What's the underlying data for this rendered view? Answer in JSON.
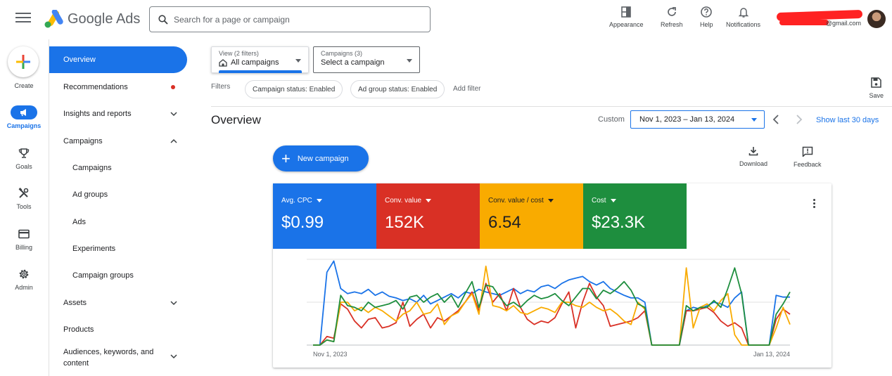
{
  "header": {
    "brand": "Google Ads",
    "search_placeholder": "Search for a page or campaign",
    "buttons": [
      {
        "label": "Appearance",
        "icon": "appearance-icon"
      },
      {
        "label": "Refresh",
        "icon": "refresh-icon"
      },
      {
        "label": "Help",
        "icon": "help-icon"
      },
      {
        "label": "Notifications",
        "icon": "bell-icon"
      }
    ],
    "account_email": "@gmail.com"
  },
  "rail": {
    "create": "Create",
    "items": [
      {
        "label": "Campaigns",
        "icon": "megaphone-icon",
        "active": true
      },
      {
        "label": "Goals",
        "icon": "trophy-icon"
      },
      {
        "label": "Tools",
        "icon": "tools-icon"
      },
      {
        "label": "Billing",
        "icon": "card-icon"
      },
      {
        "label": "Admin",
        "icon": "gear-icon"
      }
    ]
  },
  "nav": {
    "items": [
      {
        "label": "Overview",
        "active": true
      },
      {
        "label": "Recommendations",
        "dot": true
      },
      {
        "label": "Insights and reports",
        "chevron": "down"
      },
      {
        "label": "Campaigns",
        "chevron": "up"
      },
      {
        "label": "Campaigns",
        "sub": true
      },
      {
        "label": "Ad groups",
        "sub": true
      },
      {
        "label": "Ads",
        "sub": true
      },
      {
        "label": "Experiments",
        "sub": true
      },
      {
        "label": "Campaign groups",
        "sub": true
      },
      {
        "label": "Assets",
        "chevron": "down"
      },
      {
        "label": "Products"
      },
      {
        "label": "Audiences, keywords, and content",
        "chevron": "down"
      }
    ]
  },
  "toolbar": {
    "view_small": "View (2 filters)",
    "view_value": "All campaigns",
    "campaigns_small": "Campaigns (3)",
    "campaigns_value": "Select a campaign",
    "filters_label": "Filters",
    "chips": [
      "Campaign status: Enabled",
      "Ad group status: Enabled"
    ],
    "add_filter": "Add filter",
    "save": "Save"
  },
  "overview": {
    "title": "Overview",
    "custom": "Custom",
    "date_range": "Nov 1, 2023 – Jan 13, 2024",
    "show_last": "Show last 30 days",
    "new_campaign": "New campaign",
    "download": "Download",
    "feedback": "Feedback"
  },
  "metrics": [
    {
      "name": "Avg. CPC",
      "value": "$0.99",
      "color": "#1a73e8"
    },
    {
      "name": "Conv. value",
      "value": "152K",
      "color": "#d93025"
    },
    {
      "name": "Conv. value / cost",
      "value": "6.54",
      "color": "#f9ab00"
    },
    {
      "name": "Cost",
      "value": "$23.3K",
      "color": "#1e8e3e"
    }
  ],
  "chart_data": {
    "type": "line",
    "x_start": "Nov 1, 2023",
    "x_end": "Jan 13, 2024",
    "ylim": [
      0,
      1
    ],
    "grid": true,
    "series": [
      {
        "color": "#1a73e8",
        "values": [
          0,
          0,
          0.85,
          0.98,
          0.66,
          0.6,
          0.62,
          0.6,
          0.65,
          0.58,
          0.62,
          0.57,
          0.55,
          0.52,
          0.54,
          0.5,
          0.58,
          0.48,
          0.52,
          0.56,
          0.6,
          0.55,
          0.62,
          0.6,
          0.65,
          0.62,
          0.6,
          0.58,
          0.62,
          0.66,
          0.6,
          0.64,
          0.62,
          0.68,
          0.7,
          0.66,
          0.72,
          0.76,
          0.78,
          0.8,
          0.74,
          0.7,
          0.74,
          0.66,
          0.62,
          0.58,
          0.55,
          0.55,
          0.5,
          0,
          0,
          0,
          0,
          0,
          0.4,
          0.44,
          0.42,
          0.46,
          0.5,
          0.48,
          0.44,
          0.55,
          0.62,
          0,
          0,
          0,
          0,
          0.58,
          0.56,
          0.56
        ]
      },
      {
        "color": "#d93025",
        "values": [
          0,
          0,
          0.1,
          0.08,
          0.48,
          0.42,
          0.28,
          0.2,
          0.3,
          0.32,
          0.2,
          0.22,
          0.26,
          0.5,
          0.22,
          0.3,
          0.36,
          0.2,
          0.32,
          0.28,
          0.34,
          0.4,
          0.5,
          0.62,
          0.4,
          0.72,
          0.5,
          0.6,
          0.4,
          0.66,
          0.44,
          0.3,
          0.24,
          0.28,
          0.26,
          0.32,
          0.48,
          0.62,
          0.2,
          0.5,
          0.72,
          0.56,
          0.46,
          0.22,
          0.24,
          0.26,
          0.28,
          0.32,
          0.4,
          0,
          0,
          0,
          0,
          0,
          0.4,
          0.4,
          0.42,
          0.44,
          0.38,
          0.28,
          0.22,
          0.26,
          0.2,
          0,
          0,
          0,
          0,
          0.3,
          0.42,
          0.36
        ]
      },
      {
        "color": "#f9ab00",
        "values": [
          0,
          0,
          0.06,
          0.04,
          0.5,
          0.5,
          0.4,
          0.44,
          0.38,
          0.44,
          0.4,
          0.34,
          0.28,
          0.36,
          0.4,
          0.5,
          0.36,
          0.38,
          0.48,
          0.24,
          0.34,
          0.38,
          0.5,
          0.6,
          0.36,
          0.92,
          0.46,
          0.44,
          0.4,
          0.46,
          0.38,
          0.36,
          0.4,
          0.44,
          0.42,
          0.38,
          0.5,
          0.5,
          0.46,
          0.44,
          0.5,
          0.44,
          0.4,
          0.42,
          0.36,
          0.28,
          0.24,
          0.5,
          0.42,
          0,
          0,
          0,
          0,
          0,
          0.9,
          0.2,
          0.44,
          0.48,
          0.4,
          0.52,
          0.6,
          0.12,
          0,
          0,
          0,
          0,
          0,
          0.2,
          0.44,
          0.24
        ]
      },
      {
        "color": "#1e8e3e",
        "values": [
          0,
          0,
          0.06,
          0.04,
          0.58,
          0.46,
          0.44,
          0.4,
          0.5,
          0.44,
          0.46,
          0.48,
          0.52,
          0.42,
          0.56,
          0.58,
          0.5,
          0.56,
          0.6,
          0.5,
          0.58,
          0.44,
          0.6,
          0.74,
          0.44,
          0.7,
          0.68,
          0.56,
          0.46,
          0.5,
          0.44,
          0.52,
          0.58,
          0.54,
          0.56,
          0.6,
          0.52,
          0.46,
          0.56,
          0.66,
          0.66,
          0.54,
          0.64,
          0.6,
          0.66,
          0.74,
          0.64,
          0.48,
          0.44,
          0,
          0,
          0,
          0,
          0,
          0.46,
          0.4,
          0.44,
          0.44,
          0.52,
          0.44,
          0.66,
          0.9,
          0.6,
          0,
          0,
          0,
          0,
          0.36,
          0.48,
          0.62
        ]
      }
    ]
  }
}
